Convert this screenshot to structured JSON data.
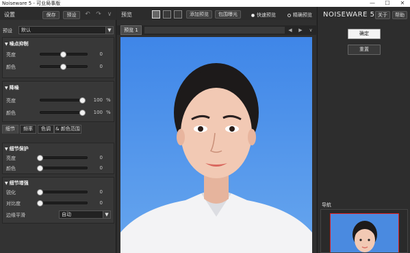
{
  "window": {
    "title": "Noiseware 5 - 可业局事版",
    "minimize": "—",
    "maximize": "☐",
    "close": "✕"
  },
  "left": {
    "settings_label": "设置",
    "save_label": "保存",
    "preset_btn_label": "预设",
    "preset_label": "预设",
    "preset_value": "默认",
    "section_noise": {
      "title": "噪点抑制",
      "rows": [
        {
          "label": "亮度",
          "value": "0",
          "level": 0.5
        },
        {
          "label": "颜色",
          "value": "0",
          "level": 0.5
        }
      ]
    },
    "section_denoise": {
      "title": "降噪",
      "rows": [
        {
          "label": "亮度",
          "value": "100",
          "unit": "%",
          "level": 1.0
        },
        {
          "label": "颜色",
          "value": "100",
          "unit": "%",
          "level": 1.0
        }
      ]
    },
    "tabs": [
      "细节",
      "频率",
      "色调",
      "& 颜色范围"
    ],
    "section_detail": {
      "title": "细节保护",
      "rows": [
        {
          "label": "亮度",
          "value": "0",
          "level": 0.0
        },
        {
          "label": "颜色",
          "value": "0",
          "level": 0.0
        }
      ]
    },
    "section_enhance": {
      "title": "细节增强",
      "rows": [
        {
          "label": "锐化",
          "value": "0",
          "level": 0.0
        },
        {
          "label": "对比度",
          "value": "0",
          "level": 0.0
        }
      ],
      "edge_label": "边缘平滑",
      "edge_value": "自动"
    }
  },
  "center": {
    "preview_label": "预览",
    "add_preview_label": "添加预览",
    "compare_label": "包围曝光",
    "fast_preview_label": "快速预览",
    "accurate_preview_label": "精确预览",
    "preview_tab_label": "预览 1",
    "nav_prev": "◀",
    "nav_next": "▶",
    "nav_down": "∨"
  },
  "right": {
    "brand": "NOISEWARE 5",
    "about_label": "关于",
    "help_label": "帮助",
    "ok_label": "确定",
    "reset_label": "重置",
    "navigator_label": "导航"
  },
  "colors": {
    "photo_bg": "#4a8ae0",
    "nav_frame": "#e02020"
  }
}
